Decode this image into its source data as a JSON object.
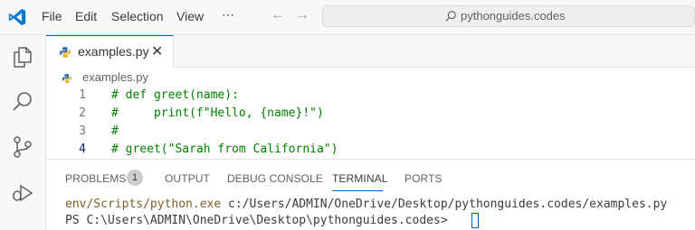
{
  "menu": {
    "items": [
      "File",
      "Edit",
      "Selection",
      "View",
      "⋯"
    ]
  },
  "search": {
    "text": "pythonguides.codes"
  },
  "editor": {
    "tab_label": "examples.py",
    "breadcrumb": "examples.py",
    "lines": [
      {
        "number": "1",
        "text": "# def greet(name):"
      },
      {
        "number": "2",
        "text": "#     print(f\"Hello, {name}!\")"
      },
      {
        "number": "3",
        "text": "#"
      },
      {
        "number": "4",
        "text": "# greet(\"Sarah from California\")"
      }
    ]
  },
  "panel": {
    "tabs": [
      "PROBLEMS",
      "OUTPUT",
      "DEBUG CONSOLE",
      "TERMINAL",
      "PORTS"
    ],
    "problems_count": "1",
    "active_tab": "TERMINAL"
  },
  "terminal": {
    "line1_cmd": "env/Scripts/python.exe",
    "line1_arg": " c:/Users/ADMIN/OneDrive/Desktop/pythonguides.codes/examples.py",
    "line2": "PS C:\\Users\\ADMIN\\OneDrive\\Desktop\\pythonguides.codes>"
  },
  "colors": {
    "accent": "#005fb8",
    "comment": "#008000",
    "terminal_cmd": "#795e26",
    "terminal_text": "#3b3b3b"
  }
}
